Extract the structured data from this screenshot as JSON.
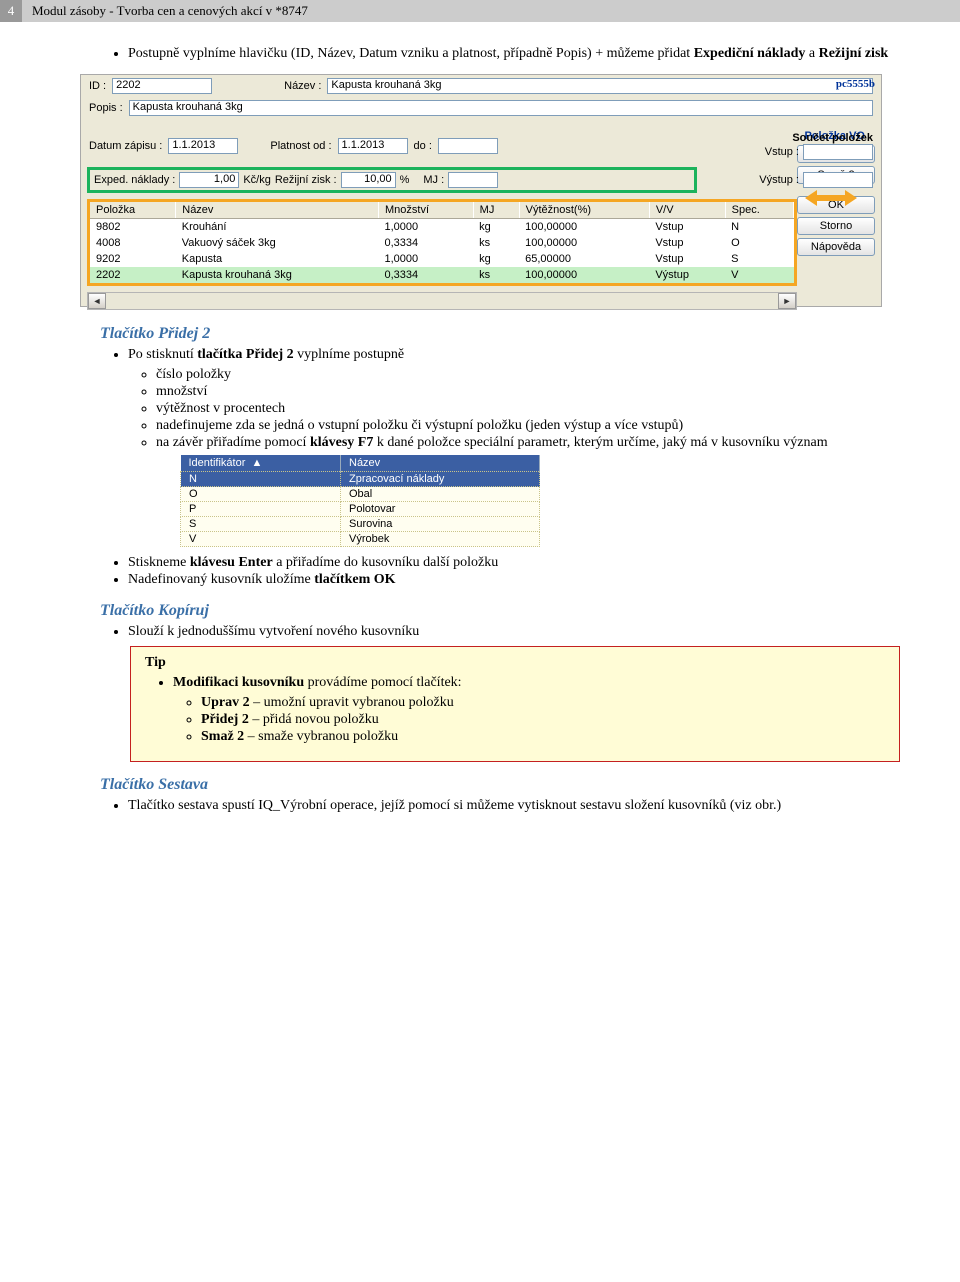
{
  "header": {
    "page": "4",
    "title": "Modul zásoby - Tvorba cen a cenových akcí v *8747"
  },
  "pc_label": "pc5555b",
  "intro_text": "Postupně vyplníme hlavičku (ID, Název, Datum vzniku a platnost, případně Popis) + můžeme přidat ",
  "intro_bold": "Expediční náklady",
  "intro_and": " a ",
  "intro_bold2": "Režijní zisk",
  "form": {
    "id_label": "ID :",
    "id_val": "2202",
    "nazev_label": "Název :",
    "nazev_val": "Kapusta krouhaná 3kg",
    "popis_label": "Popis :",
    "popis_val": "Kapusta krouhaná 3kg",
    "datum_label": "Datum zápisu :",
    "datum_val": "1.1.2013",
    "platnost_label": "Platnost od :",
    "platnost_val": "1.1.2013",
    "do_label": "do :",
    "do_val": "",
    "soucet_label": "Součet položek",
    "vstup_label": "Vstup :",
    "vstup_val": "",
    "vystup_label": "Výstup :",
    "vystup_val": "",
    "exped_label": "Exped. náklady :",
    "exped_val": "1,00",
    "exped_unit": "Kč/kg",
    "rezijni_label": "Režijní zisk :",
    "rezijni_val": "10,00",
    "rezijni_unit": "%",
    "mj_label": "MJ :",
    "mj_val": ""
  },
  "grid": {
    "headers": [
      "Položka",
      "Název",
      "Množství",
      "MJ",
      "Výtěžnost(%)",
      "V/V",
      "Spec."
    ],
    "rows": [
      [
        "9802",
        "Krouhání",
        "1,0000",
        "kg",
        "100,00000",
        "Vstup",
        "N"
      ],
      [
        "4008",
        "Vakuový sáček 3kg",
        "0,3334",
        "ks",
        "100,00000",
        "Vstup",
        "O"
      ],
      [
        "9202",
        "Kapusta",
        "1,0000",
        "kg",
        "65,00000",
        "Vstup",
        "S"
      ],
      [
        "2202",
        "Kapusta krouhaná 3kg",
        "0,3334",
        "ks",
        "100,00000",
        "Výstup",
        "V"
      ]
    ]
  },
  "side_label": "Položka VO",
  "side_buttons": {
    "pridej2": "Přidej 2",
    "smaz2": "Smaž 2",
    "ok": "OK",
    "storno": "Storno",
    "napoveda": "Nápověda"
  },
  "sect_pridej2": "Tlačítko Přidej 2",
  "pridej_text1": "Po stisknutí ",
  "pridej_text1b": "tlačítka Přidej 2",
  "pridej_text1c": " vyplníme postupně",
  "pridej_items": [
    "číslo položky",
    "množství",
    "výtěžnost v procentech",
    "nadefinujeme zda se jedná o vstupní položku či výstupní položku (jeden výstup a více vstupů)"
  ],
  "pridej_item5a": "na závěr přiřadíme pomocí ",
  "pridej_item5b": "klávesy F7",
  "pridej_item5c": " k dané položce speciální parametr, kterým určíme, jaký má v kusovníku význam",
  "mini": {
    "headers": [
      "Identifikátor",
      "Název"
    ],
    "rows": [
      [
        "N",
        "Zpracovací náklady"
      ],
      [
        "O",
        "Obal"
      ],
      [
        "P",
        "Polotovar"
      ],
      [
        "S",
        "Surovina"
      ],
      [
        "V",
        "Výrobek"
      ]
    ]
  },
  "enter_a": "Stiskneme ",
  "enter_b": "klávesu Enter",
  "enter_c": " a přiřadíme do kusovníku další položku",
  "save_a": "Nadefinovaný kusovník uložíme ",
  "save_b": "tlačítkem OK",
  "sect_kopiruj": "Tlačítko Kopíruj",
  "kopiruj_text": "Slouží k jednoduššímu vytvoření nového kusovníku",
  "tip_label": "Tip",
  "tip_a": "Modifikaci kusovníku",
  "tip_b": " provádíme pomocí tlačítek:",
  "tip_items": [
    {
      "b": "Uprav 2",
      "t": " – umožní upravit vybranou položku"
    },
    {
      "b": "Přidej 2",
      "t": " – přidá novou položku"
    },
    {
      "b": "Smaž 2",
      "t": "  – smaže vybranou položku"
    }
  ],
  "sect_sestava": "Tlačítko Sestava",
  "sestava_text": "Tlačítko sestava spustí IQ_Výrobní operace, jejíž pomocí si můžeme vytisknout sestavu složení kusovníků (viz obr.)"
}
